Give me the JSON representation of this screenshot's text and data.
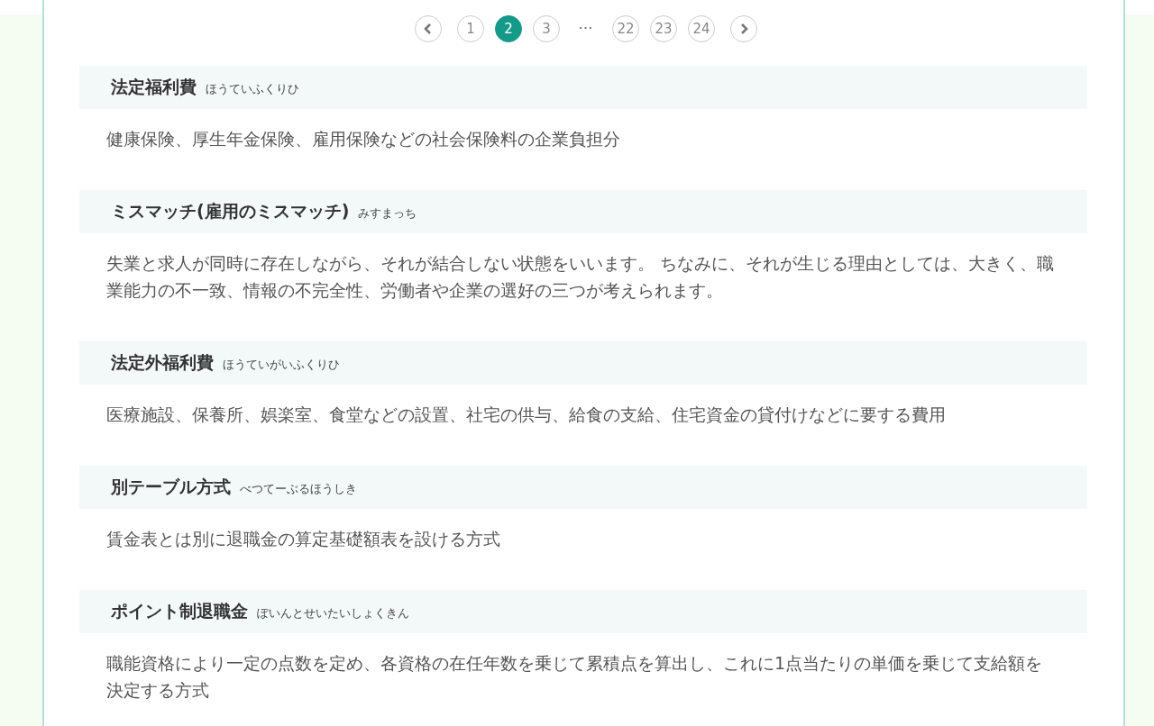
{
  "pagination": [
    {
      "kind": "prev"
    },
    {
      "kind": "page",
      "label": "1",
      "selected": false
    },
    {
      "kind": "page",
      "label": "2",
      "selected": true
    },
    {
      "kind": "page",
      "label": "3",
      "selected": false
    },
    {
      "kind": "ellipsis",
      "label": "…"
    },
    {
      "kind": "page",
      "label": "22",
      "selected": false
    },
    {
      "kind": "page",
      "label": "23",
      "selected": false
    },
    {
      "kind": "page",
      "label": "24",
      "selected": false
    },
    {
      "kind": "next"
    }
  ],
  "terms": [
    {
      "term": "法定福利費",
      "reading": "ほうていふくりひ",
      "definition": "健康保険、厚生年金保険、雇用保険などの社会保険料の企業負担分"
    },
    {
      "term": "ミスマッチ(雇用のミスマッチ)",
      "reading": "みすまっち",
      "definition": "失業と求人が同時に存在しながら、それが結合しない状態をいいます。 ちなみに、それが生じる理由としては、大きく、職業能力の不一致、情報の不完全性、労働者や企業の選好の三つが考えられます。"
    },
    {
      "term": "法定外福利費",
      "reading": "ほうていがいふくりひ",
      "definition": "医療施設、保養所、娯楽室、食堂などの設置、社宅の供与、給食の支給、住宅資金の貸付けなどに要する費用"
    },
    {
      "term": "別テーブル方式",
      "reading": "べつてーぶるほうしき",
      "definition": "賃金表とは別に退職金の算定基礎額表を設ける方式"
    },
    {
      "term": "ポイント制退職金",
      "reading": "ぽいんとせいたいしょくきん",
      "definition": "職能資格により一定の点数を定め、各資格の在任年数を乗じて累積点を算出し、これに1点当たりの単価を乗じて支給額を決定する方式"
    }
  ]
}
